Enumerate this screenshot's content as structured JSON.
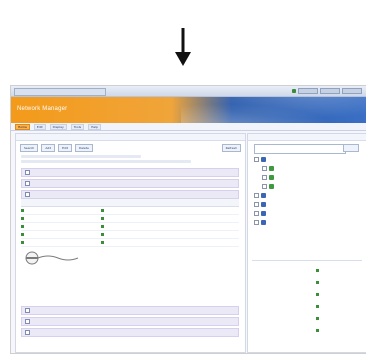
{
  "window": {
    "brand": "Network Manager",
    "titlebar_left": "",
    "titlebar_right": ""
  },
  "nav": {
    "items": [
      {
        "label": "Home",
        "active": true
      },
      {
        "label": "Edit",
        "active": false
      },
      {
        "label": "Display",
        "active": false
      },
      {
        "label": "Tools",
        "active": false
      },
      {
        "label": "Help",
        "active": false
      }
    ]
  },
  "left_panel": {
    "title": "",
    "toolbar": {
      "buttons": [
        {
          "label": "Search"
        },
        {
          "label": "Add"
        },
        {
          "label": "Edit"
        },
        {
          "label": "Delete"
        }
      ],
      "right_button": {
        "label": "Refresh"
      }
    },
    "selection_items": [
      {
        "label": ""
      },
      {
        "label": ""
      },
      {
        "label": ""
      }
    ],
    "grid": {
      "headers": [
        "",
        "",
        "",
        "",
        ""
      ],
      "rows": [
        {
          "c1": "",
          "c2": "",
          "c3": "",
          "c4": "",
          "c5": ""
        },
        {
          "c1": "",
          "c2": "",
          "c3": "",
          "c4": "",
          "c5": ""
        },
        {
          "c1": "",
          "c2": "",
          "c3": "",
          "c4": "",
          "c5": ""
        },
        {
          "c1": "",
          "c2": "",
          "c3": "",
          "c4": "",
          "c5": ""
        },
        {
          "c1": "",
          "c2": "",
          "c3": "",
          "c4": "",
          "c5": ""
        }
      ]
    },
    "bottom_items": [
      {
        "label": ""
      },
      {
        "label": ""
      },
      {
        "label": ""
      }
    ]
  },
  "right_panel": {
    "title": "",
    "search_placeholder": "",
    "search_button": "",
    "tree": [
      {
        "label": "",
        "level": 0
      },
      {
        "label": "",
        "level": 1
      },
      {
        "label": "",
        "level": 1
      },
      {
        "label": "",
        "level": 1
      },
      {
        "label": "",
        "level": 0
      },
      {
        "label": "",
        "level": 0
      },
      {
        "label": "",
        "level": 0
      },
      {
        "label": "",
        "level": 0
      }
    ],
    "events_title": "",
    "events": [
      {
        "date": "",
        "desc": "",
        "status": ""
      },
      {
        "date": "",
        "desc": "",
        "status": ""
      },
      {
        "date": "",
        "desc": "",
        "status": ""
      },
      {
        "date": "",
        "desc": "",
        "status": ""
      },
      {
        "date": "",
        "desc": "",
        "status": ""
      },
      {
        "date": "",
        "desc": "",
        "status": ""
      }
    ]
  }
}
